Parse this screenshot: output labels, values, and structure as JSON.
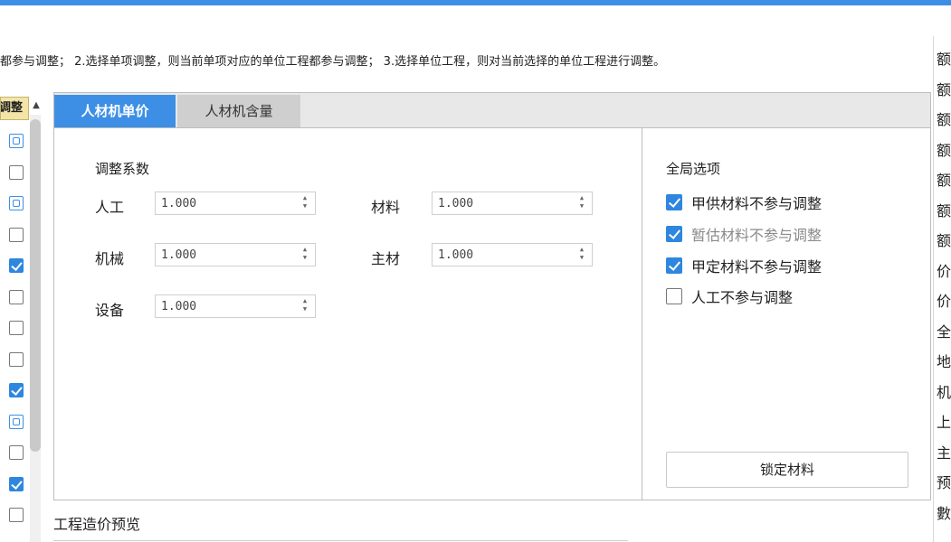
{
  "instructions": "都参与调整； 2.选择单项调整，则当前单项对应的单位工程都参与调整； 3.选择单位工程，则对当前选择的单位工程进行调整。",
  "left_column": {
    "header": "调整",
    "rows": [
      "partial",
      "unchecked",
      "partial",
      "unchecked",
      "checked",
      "unchecked",
      "unchecked",
      "unchecked",
      "checked",
      "partial",
      "unchecked",
      "checked",
      "unchecked"
    ]
  },
  "tabs": [
    {
      "label": "人材机单价",
      "active": true
    },
    {
      "label": "人材机含量",
      "active": false
    }
  ],
  "adjust": {
    "title": "调整系数",
    "fields": {
      "labor": {
        "label": "人工",
        "value": "1.000"
      },
      "material": {
        "label": "材料",
        "value": "1.000"
      },
      "machine": {
        "label": "机械",
        "value": "1.000"
      },
      "main_material": {
        "label": "主材",
        "value": "1.000"
      },
      "equipment": {
        "label": "设备",
        "value": "1.000"
      }
    }
  },
  "global_options": {
    "title": "全局选项",
    "items": [
      {
        "label": "甲供材料不参与调整",
        "checked": true,
        "enabled": true
      },
      {
        "label": "暂估材料不参与调整",
        "checked": true,
        "enabled": false
      },
      {
        "label": "甲定材料不参与调整",
        "checked": true,
        "enabled": true
      },
      {
        "label": "人工不参与调整",
        "checked": false,
        "enabled": true
      }
    ],
    "lock_button": "锁定材料"
  },
  "preview_label": "工程造价预览",
  "right_column_cells": [
    "额",
    "额",
    "额",
    "额",
    "额",
    "额",
    "额",
    "价",
    "价",
    "全",
    "地",
    "机",
    "上",
    "主",
    "预",
    "數"
  ],
  "colors": {
    "accent": "#3d8fe6",
    "checkbox": "#2e86de",
    "header_yellow": "#f2e5a8"
  }
}
